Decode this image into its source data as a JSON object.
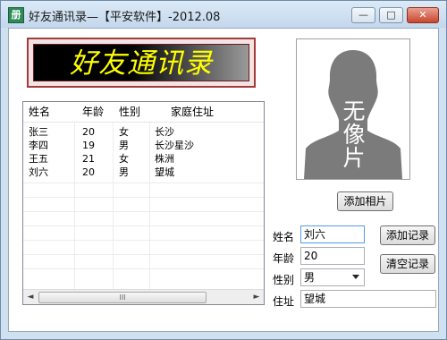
{
  "window": {
    "title": "好友通讯录—【平安软件】-2012.08",
    "app_icon": "address-book-icon",
    "controls": {
      "minimize": "—",
      "maximize": "□",
      "close": "✕"
    }
  },
  "banner": {
    "text": "好友通讯录"
  },
  "list": {
    "columns": [
      "姓名",
      "年龄",
      "性别",
      "家庭住址"
    ],
    "rows": [
      [
        "张三",
        "20",
        "女",
        "长沙"
      ],
      [
        "李四",
        "19",
        "男",
        "长沙星沙"
      ],
      [
        "王五",
        "21",
        "女",
        "株洲"
      ],
      [
        "刘六",
        "20",
        "男",
        "望城"
      ]
    ],
    "scrollbar": {
      "left_arrow": "◄",
      "right_arrow": "►",
      "thumb_grip": "III"
    }
  },
  "photo": {
    "placeholder_text": "无像片",
    "icon": "person-silhouette-icon"
  },
  "buttons": {
    "add_photo": "添加相片",
    "add_record": "添加记录",
    "clear_record": "清空记录"
  },
  "form": {
    "name_label": "姓名",
    "name_value": "刘六",
    "age_label": "年龄",
    "age_value": "20",
    "gender_label": "性别",
    "gender_value": "男",
    "address_label": "住址",
    "address_value": "望城"
  },
  "colors": {
    "banner_text": "#ffff00",
    "banner_border": "#a33a3a",
    "close_button": "#c9462e"
  }
}
